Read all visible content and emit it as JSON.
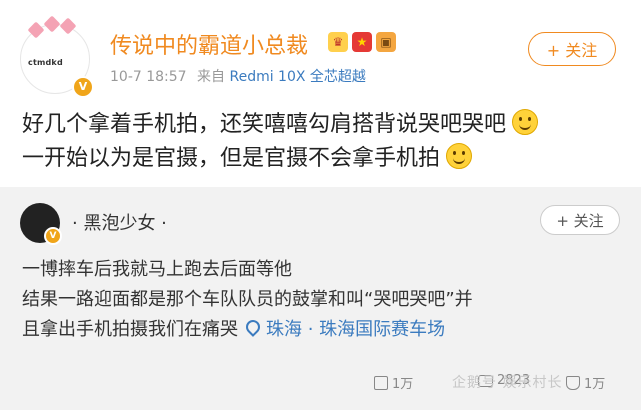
{
  "post": {
    "avatar_text": "ctmdkd",
    "username": "传说中的霸道小总裁",
    "badges": [
      "crown-badge-icon",
      "flag-badge-icon",
      "package-badge-icon"
    ],
    "date": "10-7 18:57",
    "source_prefix": "来自",
    "device": "Redmi 10X 全芯超越",
    "follow_label": "+ 关注",
    "lines": [
      "好几个拿着手机拍，还笑嘻嘻勾肩搭背说哭吧哭吧",
      "一开始以为是官摄，但是官摄不会拿手机拍"
    ]
  },
  "repost": {
    "username": "· 黑泡少女 ·",
    "follow_label": "+ 关注",
    "lines": [
      "一博摔车后我就马上跑去后面等他",
      "结果一路迎面都是那个车队队员的鼓掌和叫“哭吧哭吧”并",
      "且拿出手机拍摄我们在痛哭"
    ],
    "location": "珠海 · 珠海国际赛车场",
    "stats": {
      "reposts": "1万",
      "comments": "2823",
      "likes": "1万"
    }
  },
  "watermark": "企鹅号 娱乐村长",
  "colors": {
    "username": "#f08a20",
    "device": "#3b7bbf",
    "repost_bg": "#f2f2f2"
  }
}
